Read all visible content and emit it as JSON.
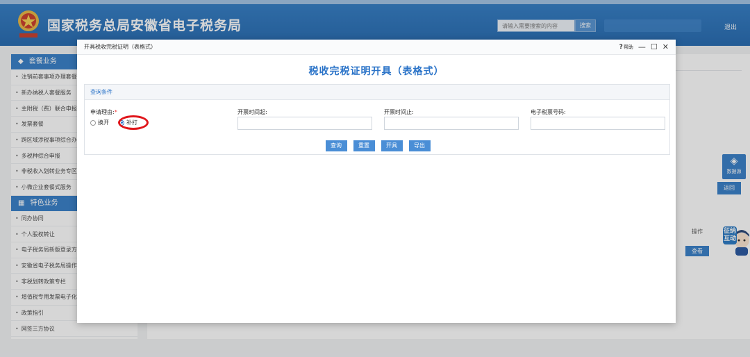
{
  "header": {
    "site_title": "国家税务总局安徽省电子税务局",
    "search_placeholder": "请输入需要搜索的内容",
    "search_button": "搜索",
    "logout": "退出"
  },
  "sidebar": {
    "sections": [
      {
        "title": "套餐业务",
        "icon": "package-icon",
        "items": [
          "注销前套事项办理套餐",
          "新办纳税人套餐服务",
          "主附税（费）联合申报",
          "发票套餐",
          "跨区域涉税事项综合办",
          "多税种综合申报",
          "非税收入划转业务专区",
          "小微企业套餐式服务"
        ]
      },
      {
        "title": "特色业务",
        "icon": "grid-icon",
        "items": [
          "同办协同",
          "个人股权转让",
          "电子税务局新版登录方",
          "安徽省电子税务局操作",
          "非税划转政策专栏",
          "增值税专用发票电子化",
          "政策指引",
          "网签三方协议"
        ]
      }
    ]
  },
  "background": {
    "return_button": "返回",
    "op_header": "操作",
    "view_button": "查看",
    "float_tool_label": "数据源",
    "mascot_text": "征纳互动"
  },
  "modal": {
    "window_title": "开具税收完税证明（表格式）",
    "help_label": "帮助",
    "main_title": "税收完税证明开具（表格式）",
    "query_section": "查询条件",
    "fields": {
      "reason_label": "申请理由:",
      "required_mark": "*",
      "start_label": "开票时间起:",
      "end_label": "开票时间止:",
      "ticket_no_label": "电子税票号码:"
    },
    "radio_options": [
      {
        "label": "换开",
        "checked": false
      },
      {
        "label": "补打",
        "checked": true
      }
    ],
    "buttons": {
      "query": "查询",
      "reset": "重置",
      "issue": "开具",
      "export": "导出"
    }
  },
  "colors": {
    "brand_blue": "#2a73c8",
    "header_blue": "#1b63ad",
    "highlight_red": "#e0161b"
  }
}
